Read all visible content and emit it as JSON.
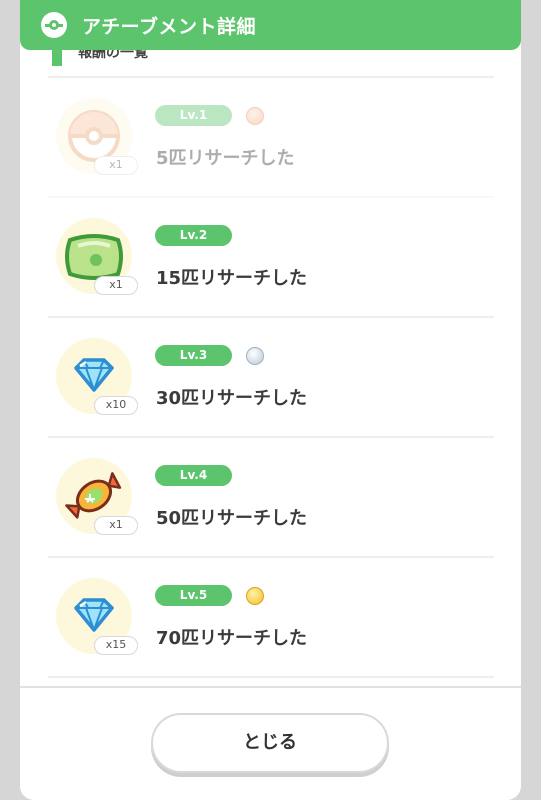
{
  "header": {
    "title": "アチーブメント詳細",
    "icon": "pokeball-icon",
    "color": "#5cc46d"
  },
  "section": {
    "label": "報酬の一覧"
  },
  "items": [
    {
      "level": "Lv.1",
      "medal": "bronze",
      "description": "5匹リサーチした",
      "reward_icon": "pokeball-icon",
      "quantity": "x1",
      "dimmed": true
    },
    {
      "level": "Lv.2",
      "medal": "",
      "description": "15匹リサーチした",
      "reward_icon": "pillow-icon",
      "quantity": "x1",
      "dimmed": false
    },
    {
      "level": "Lv.3",
      "medal": "silver",
      "description": "30匹リサーチした",
      "reward_icon": "diamond-icon",
      "quantity": "x10",
      "dimmed": false
    },
    {
      "level": "Lv.4",
      "medal": "",
      "description": "50匹リサーチした",
      "reward_icon": "candy-icon",
      "quantity": "x1",
      "dimmed": false
    },
    {
      "level": "Lv.5",
      "medal": "gold",
      "description": "70匹リサーチした",
      "reward_icon": "diamond-icon",
      "quantity": "x15",
      "dimmed": false
    }
  ],
  "footer": {
    "close_label": "とじる"
  }
}
